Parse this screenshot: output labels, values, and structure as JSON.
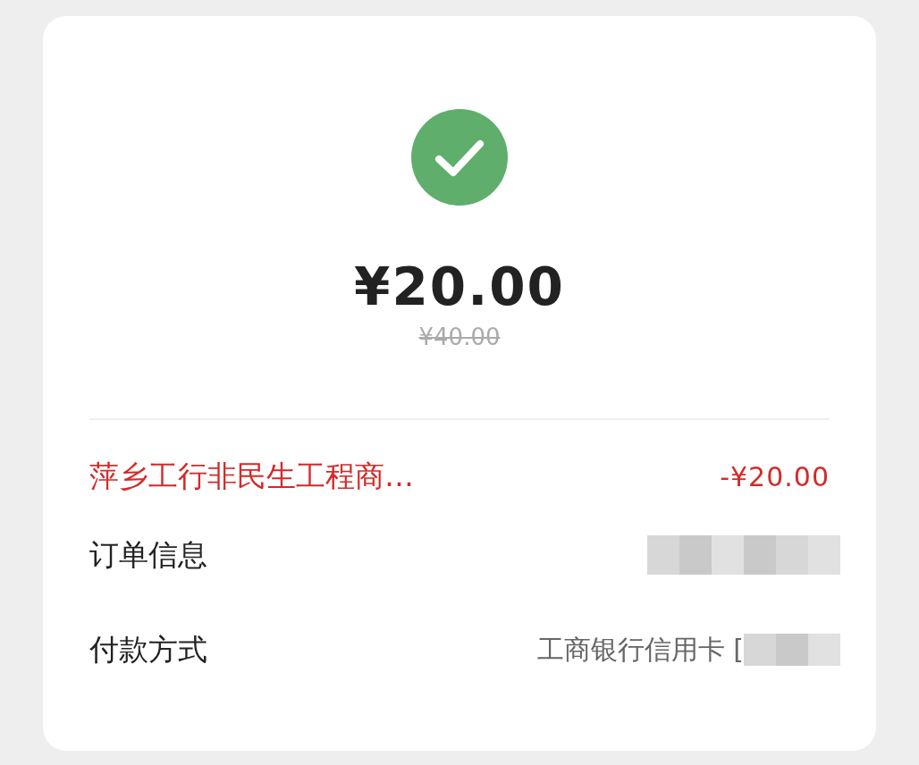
{
  "status": {
    "kind": "success"
  },
  "amount": "¥20.00",
  "original_amount": "¥40.00",
  "rows": [
    {
      "kind": "merchant",
      "label": "萍乡工行非民生工程商…",
      "value": "-¥20.00",
      "redacted": false
    },
    {
      "kind": "plain",
      "label": "订单信息",
      "redacted": true
    },
    {
      "kind": "plain",
      "label": "付款方式",
      "value": "工商银行信用卡 [",
      "redacted": true
    }
  ]
}
